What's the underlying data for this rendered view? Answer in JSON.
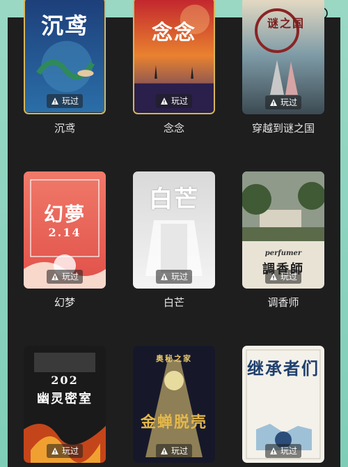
{
  "icons": {
    "top_corner": "circle-arrow-icon",
    "played": "warning-triangle-icon"
  },
  "played_label": "玩过",
  "games": [
    {
      "title": "沉鸢",
      "cover_text": "沉鸢",
      "cover_small": "",
      "border": "#d8b557"
    },
    {
      "title": "念念",
      "cover_text": "念念",
      "cover_small": "",
      "border": "#d8b557"
    },
    {
      "title": "穿越到谜之国",
      "cover_text": "谜之国",
      "cover_small": "",
      "border": ""
    },
    {
      "title": "幻梦",
      "cover_text": "幻夢",
      "cover_small": "2.14",
      "border": ""
    },
    {
      "title": "白芒",
      "cover_text": "白芒",
      "cover_small": "",
      "border": ""
    },
    {
      "title": "调香师",
      "cover_text": "調香師",
      "cover_small": "perfumer",
      "border": ""
    },
    {
      "title": "",
      "cover_text": "幽灵密室",
      "cover_small": "202",
      "border": ""
    },
    {
      "title": "",
      "cover_text": "金蝉脱壳",
      "cover_small": "奥秘之家",
      "border": ""
    },
    {
      "title": "",
      "cover_text": "继承者们",
      "cover_small": "",
      "border": ""
    }
  ]
}
